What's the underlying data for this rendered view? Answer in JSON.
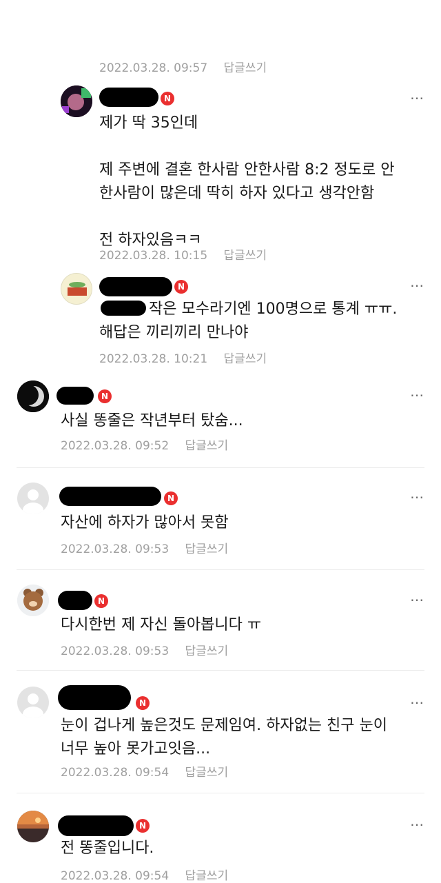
{
  "reply_label": "답글쓰기",
  "badge_label": "N",
  "more_icon": "⋯",
  "top_meta": {
    "date": "2022.03.28. 09:57"
  },
  "comments": [
    {
      "text": "제가 딱 35인데\n\n제 주변에 결혼 한사람 안한사람 8:2 정도로 안\n한사람이 많은데 딱히 하자 있다고 생각안함\n\n전 하자있음ㅋㅋ",
      "date": "2022.03.28. 10:15"
    },
    {
      "text": "작은 모수라기엔 100명으로 통계 ㅠㅠ.\n해답은 끼리끼리 만나야",
      "date": "2022.03.28. 10:21"
    },
    {
      "text": "사실 똥줄은 작년부터 탔숨...",
      "date": "2022.03.28. 09:52"
    },
    {
      "text": "자산에 하자가 많아서 못함",
      "date": "2022.03.28. 09:53"
    },
    {
      "text": "다시한번 제 자신 돌아봅니다 ㅠ",
      "date": "2022.03.28. 09:53"
    },
    {
      "text": "눈이 겁나게 높은것도 문제임여. 하자없는 친구 눈이\n너무 높아 못가고잇음...",
      "date": "2022.03.28. 09:54"
    },
    {
      "text": "전 똥줄입니다.",
      "date": "2022.03.28. 09:54"
    }
  ]
}
